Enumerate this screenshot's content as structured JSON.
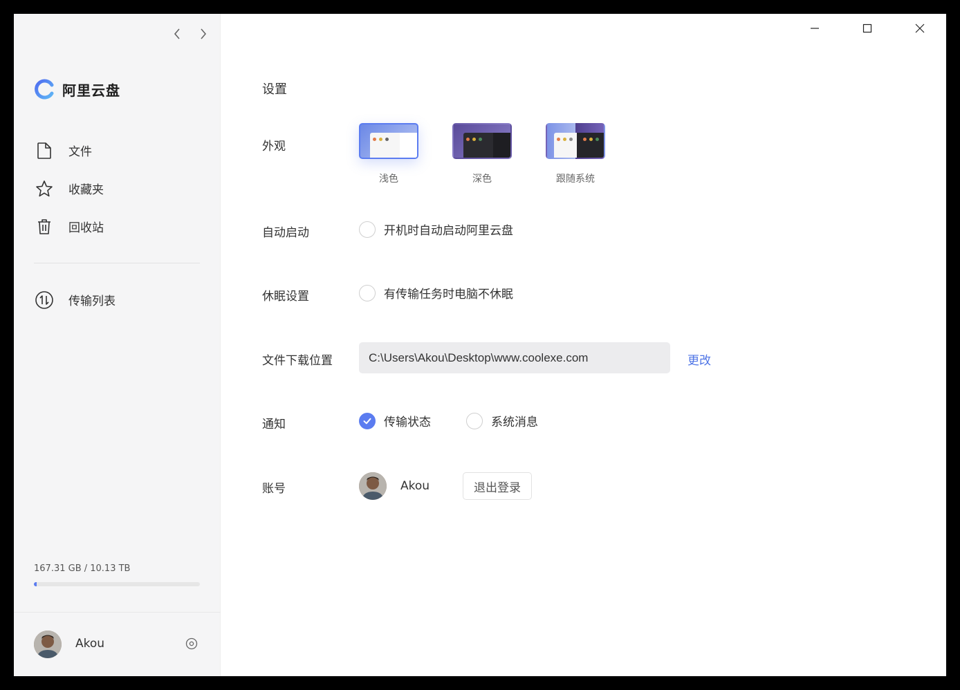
{
  "app": {
    "name": "阿里云盘",
    "brand_color": "#5b7cf0"
  },
  "sidebar": {
    "items": [
      {
        "label": "文件",
        "icon": "file-icon"
      },
      {
        "label": "收藏夹",
        "icon": "star-icon"
      },
      {
        "label": "回收站",
        "icon": "trash-icon"
      }
    ],
    "transfer": {
      "label": "传输列表",
      "icon": "transfer-icon"
    },
    "storage": {
      "text": "167.31 GB / 10.13 TB",
      "used_fraction": 0.016
    },
    "user": {
      "name": "Akou"
    }
  },
  "settings": {
    "title": "设置",
    "appearance": {
      "label": "外观",
      "options": [
        {
          "name": "浅色",
          "selected": true
        },
        {
          "name": "深色",
          "selected": false
        },
        {
          "name": "跟随系统",
          "selected": false
        }
      ]
    },
    "autostart": {
      "label": "自动启动",
      "option": "开机时自动启动阿里云盘",
      "checked": false
    },
    "sleep": {
      "label": "休眠设置",
      "option": "有传输任务时电脑不休眠",
      "checked": false
    },
    "download": {
      "label": "文件下载位置",
      "path": "C:\\Users\\Akou\\Desktop\\www.coolexe.com",
      "change": "更改"
    },
    "notify": {
      "label": "通知",
      "transfer": {
        "text": "传输状态",
        "checked": true
      },
      "system": {
        "text": "系统消息",
        "checked": false
      }
    },
    "account": {
      "label": "账号",
      "name": "Akou",
      "logout": "退出登录"
    }
  }
}
